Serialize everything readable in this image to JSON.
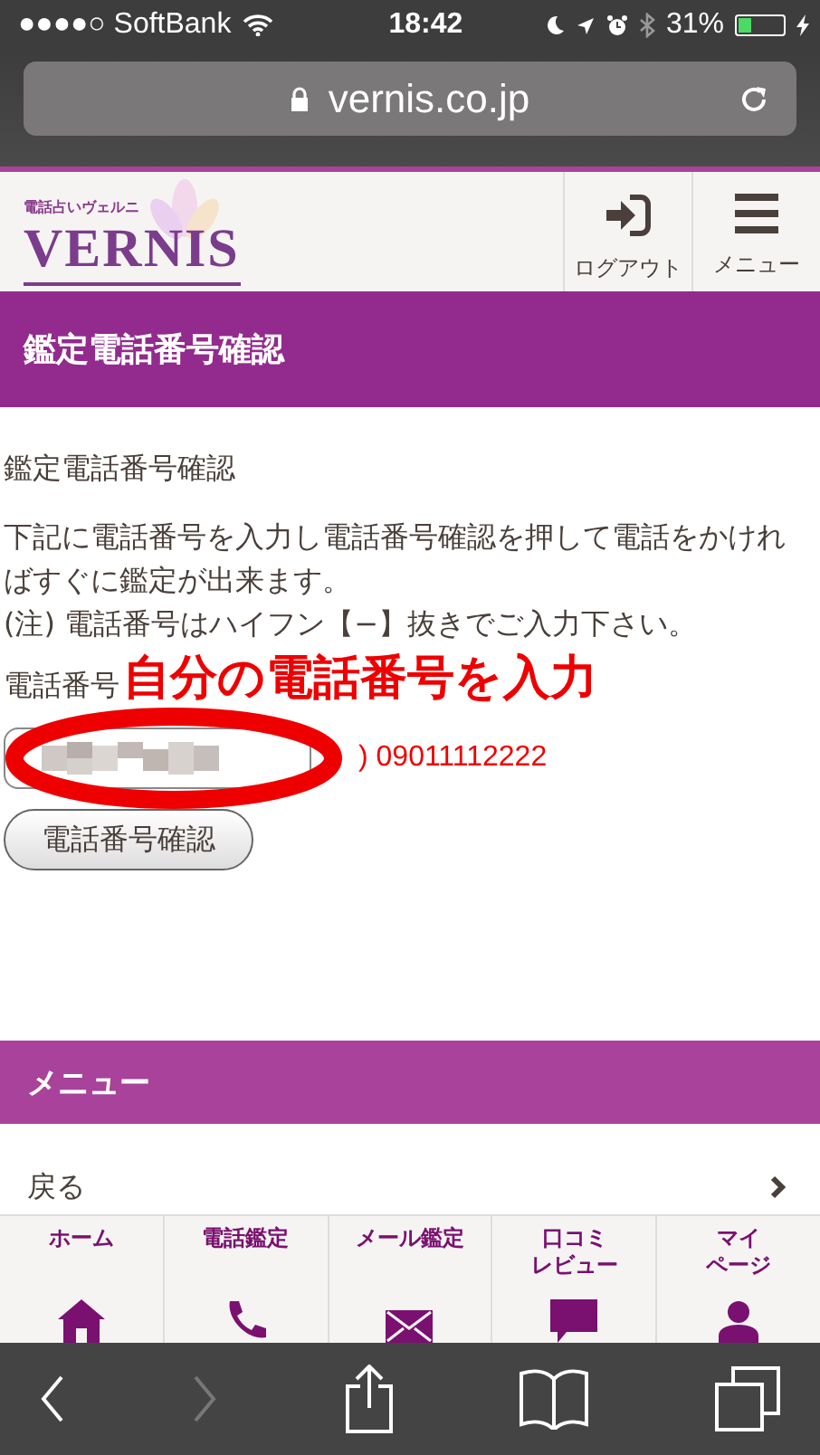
{
  "status_bar": {
    "carrier": "●●●●○ SoftBank",
    "time": "18:42",
    "battery": "31%",
    "charging": true
  },
  "address_bar": {
    "url": "vernis.co.jp"
  },
  "header": {
    "logo_tagline": "電話占いヴェルニ",
    "logo": "VERNIS",
    "buttons": [
      {
        "label": "ログアウト",
        "kind": "logout"
      },
      {
        "label": "メニュー",
        "kind": "menu"
      }
    ]
  },
  "page_title": "鑑定電話番号確認",
  "content": {
    "heading": "鑑定電話番号確認",
    "instructions": "下記に電話番号を入力し電話番号確認を押して電話をかければすぐに鑑定が出来ます。",
    "note": "(注) 電話番号はハイフン【−】抜きでご入力下さい。",
    "field_label": "電話番号",
    "annotation": "自分の電話番号を入力",
    "example": ") 09011112222",
    "confirm_button": "電話番号確認"
  },
  "menu": {
    "title": "メニュー",
    "items": [
      {
        "label": "戻る"
      }
    ]
  },
  "tab_bar": [
    {
      "lines": [
        "ホーム"
      ],
      "kind": "home"
    },
    {
      "lines": [
        "電話鑑定"
      ],
      "kind": "phone"
    },
    {
      "lines": [
        "メール鑑定"
      ],
      "kind": "mail"
    },
    {
      "lines": [
        "口コミ",
        "レビュー"
      ],
      "kind": "review"
    },
    {
      "lines": [
        "マイ",
        "ページ"
      ],
      "kind": "mypage"
    }
  ],
  "toolbar": {
    "forward_disabled": true
  }
}
